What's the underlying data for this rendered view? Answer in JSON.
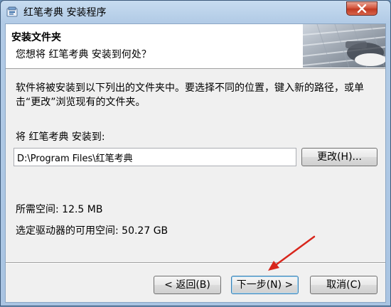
{
  "window": {
    "title": "红笔考典 安装程序"
  },
  "header": {
    "title": "安装文件夹",
    "subtitle": "您想将 红笔考典 安装到何处？"
  },
  "body": {
    "description": "软件将被安装到以下列出的文件夹中。要选择不同的位置，键入新的路径，或单击“更改”浏览现有的文件夹。",
    "destination_label": "将 红笔考典 安装到:",
    "install_path": "D:\\Program Files\\红笔考典",
    "change_button": "更改(H)...",
    "space_required": "所需空间: 12.5 MB",
    "space_available": "选定驱动器的可用空间: 50.27 GB"
  },
  "buttons": {
    "back": "< 返回(B)",
    "next": "下一步(N) >",
    "cancel": "取消(C)"
  },
  "icons": {
    "app": "app-icon",
    "close": "close-icon",
    "arrow": "arrow-annotation-icon"
  },
  "colors": {
    "close_button": "#c8452c",
    "annotation_arrow": "#d8261c",
    "default_button_border": "#3c7fb1"
  }
}
